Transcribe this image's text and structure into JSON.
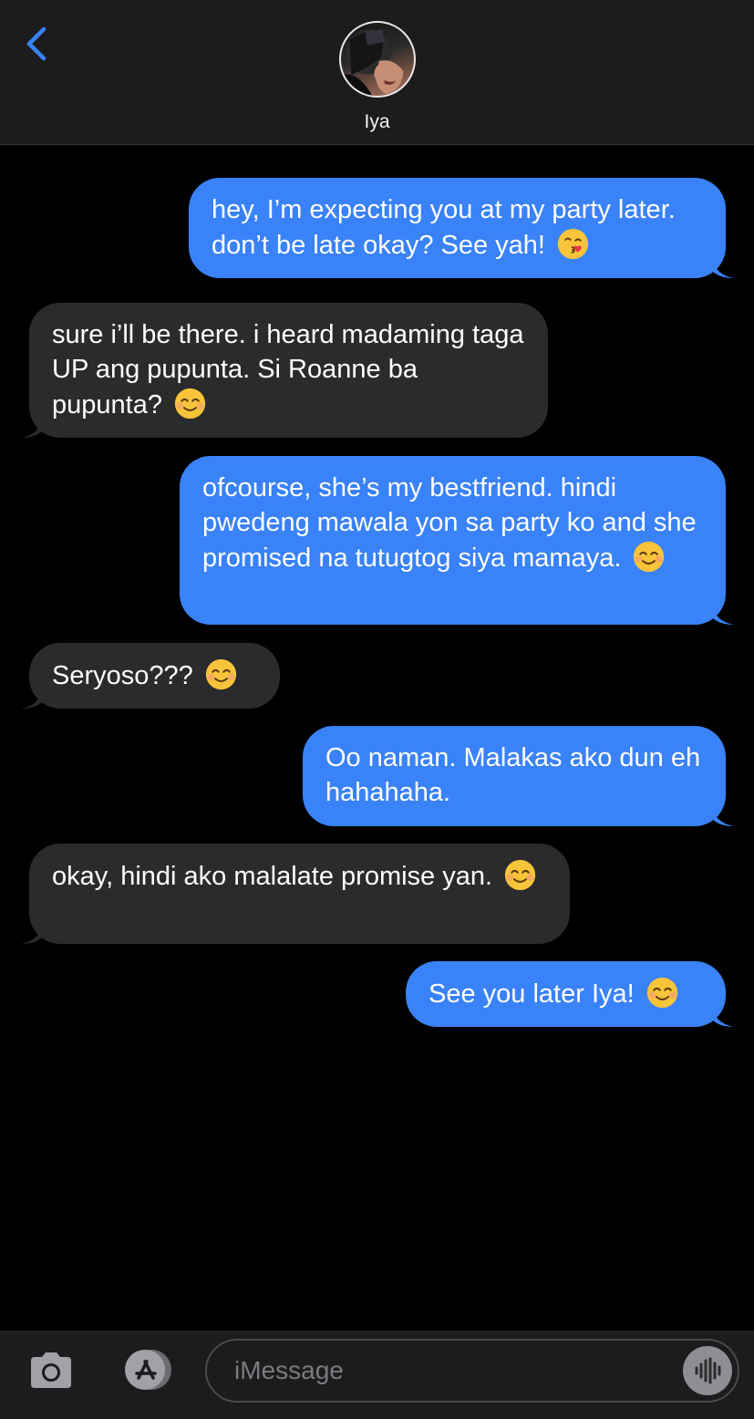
{
  "header": {
    "contact_name": "Iya",
    "back_icon": "chevron-left-icon",
    "accent_color": "#3a82f7"
  },
  "messages": [
    {
      "direction": "out",
      "text": "hey, I’m expecting you at my party later. don’t be late okay? See yah!",
      "emoji": "kissing-face-emoji"
    },
    {
      "direction": "in",
      "text": "sure i’ll be there. i heard madaming taga UP ang pupunta. Si Roanne ba pupunta?",
      "emoji": "smiling-face-emoji"
    },
    {
      "direction": "out",
      "text": "ofcourse, she’s my bestfriend. hindi pwedeng mawala yon sa party ko and she promised na tutugtog siya mamaya.",
      "emoji": "smiling-face-emoji"
    },
    {
      "direction": "in",
      "text": "Seryoso???",
      "emoji": "smiling-face-emoji"
    },
    {
      "direction": "out",
      "text": "Oo naman. Malakas ako dun eh hahahaha.",
      "emoji": ""
    },
    {
      "direction": "in",
      "text": "okay, hindi ako malalate promise yan.",
      "emoji": "smiling-face-emoji"
    },
    {
      "direction": "out",
      "text": "See you later Iya!",
      "emoji": "smiling-face-emoji"
    }
  ],
  "colors": {
    "outgoing_bubble": "#3a82f7",
    "incoming_bubble": "#2b2b2d",
    "background": "#000000"
  },
  "composer": {
    "placeholder": "iMessage",
    "camera_icon": "camera-icon",
    "apps_icon": "app-store-icon",
    "audio_icon": "audio-waveform-icon"
  }
}
